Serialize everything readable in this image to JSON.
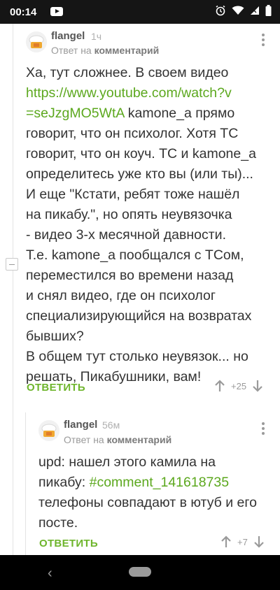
{
  "status": {
    "time": "00:14"
  },
  "comments": [
    {
      "author": "flangel",
      "age": "1ч",
      "reply_prefix": "Ответ на",
      "reply_target": "комментарий",
      "lines": [
        "Ха, тут сложнее. В своем видео",
        "https://www.youtube.com/watch?v",
        "=seJzgMO5WtA",
        " kamone_a прямо",
        "говорит, что он психолог. Хотя ТС",
        "говорит, что он коуч. ТС и kamone_a",
        "определитесь уже кто вы (или ты)...",
        "И еще \"Кстати, ребят тоже нашёл",
        "на пикабу.\", но опять неувязочка",
        "- видео 3-х месячной давности.",
        "Т.е. kamone_a пообщался с ТСом,",
        "переместился во времени назад",
        "и снял видео, где он психолог",
        "специализирующийся на возвратах",
        "бывших?",
        "В общем тут столько неувязок... но",
        "решать, Пикабушники, вам!"
      ],
      "reply_label": "ОТВЕТИТЬ",
      "rating": "+25"
    },
    {
      "author": "flangel",
      "age": "56м",
      "reply_prefix": "Ответ на",
      "reply_target": "комментарий",
      "lines": [
        "upd: нашел этого камила на",
        "пикабу: ",
        "#comment_141618735",
        "телефоны совпадают в ютуб и его",
        "посте."
      ],
      "reply_label": "ОТВЕТИТЬ",
      "rating": "+7"
    }
  ]
}
